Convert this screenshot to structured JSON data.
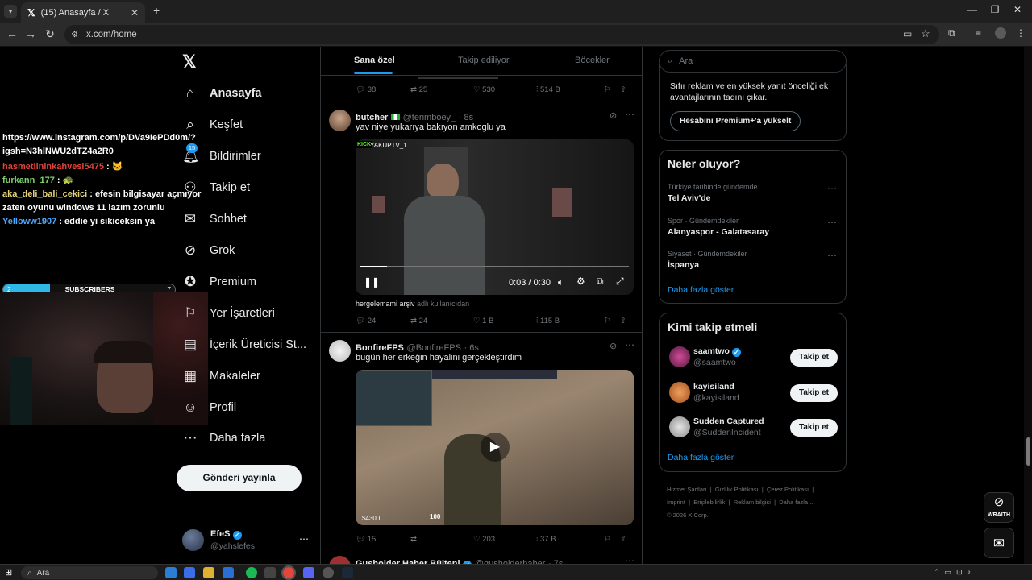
{
  "browser": {
    "tab_title": "(15) Anasayfa / X",
    "url": "x.com/home"
  },
  "overlay": {
    "chat": [
      {
        "user": "",
        "text": "https://www.instagram.com/p/DVa9IePDd0m/?igsh=N3hlNWU2dTZ4a2R0",
        "color": "#ffffff"
      },
      {
        "user": "hasmetlininkahvesi5475",
        "text": " : 🐱",
        "color": "#e0433a"
      },
      {
        "user": "furkann_177",
        "text": " : 🐢",
        "color": "#7bd16b"
      },
      {
        "user": "aka_deli_bali_cekici",
        "text": " : efesin bilgisayar açmıyor zaten oyunu windows 11 lazım zorunlu",
        "color": "#e3d37a"
      },
      {
        "user": "Yelloww1907",
        "text": " : eddie yi sikiceksin ya",
        "color": "#4aa8ff"
      }
    ],
    "subs_label": "SUBSCRIBERS",
    "subs_current": "2",
    "subs_goal": "7",
    "subs_progress": 0.27
  },
  "nav": {
    "items": [
      {
        "label": "Anasayfa",
        "icon": "home-icon"
      },
      {
        "label": "Keşfet",
        "icon": "search-icon"
      },
      {
        "label": "Bildirimler",
        "icon": "bell-icon",
        "badge": "15"
      },
      {
        "label": "Takip et",
        "icon": "follow-icon"
      },
      {
        "label": "Sohbet",
        "icon": "mail-icon"
      },
      {
        "label": "Grok",
        "icon": "grok-icon"
      },
      {
        "label": "Premium",
        "icon": "premium-icon"
      },
      {
        "label": "Yer İşaretleri",
        "icon": "bookmark-icon"
      },
      {
        "label": "İçerik Üreticisi St...",
        "icon": "creator-icon"
      },
      {
        "label": "Makaleler",
        "icon": "article-icon"
      },
      {
        "label": "Profil",
        "icon": "profile-icon"
      },
      {
        "label": "Daha fazla",
        "icon": "more-icon"
      }
    ],
    "post_button": "Gönderi yayınla",
    "account_name": "EfeS",
    "account_handle": "@yahslefes"
  },
  "feed": {
    "tabs": [
      "Sana özel",
      "Takip ediliyor",
      "Böcekler"
    ],
    "top_actions": {
      "replies": "38",
      "reposts": "25",
      "likes": "530",
      "views": "514 B"
    },
    "tweets": [
      {
        "name": "butcher",
        "handle": "@terimboey_",
        "time": "· 8s",
        "text": "yav niye yukarıya bakıyon amkoglu ya",
        "video_tag": "YAKUPTV_1",
        "video_time": "0:03 / 0:30",
        "video_progress": 0.1,
        "source": "hergelemami arşiv",
        "source_sub": "adlı kullanıcıdan",
        "actions": {
          "replies": "24",
          "reposts": "24",
          "likes": "1 B",
          "views": "115 B"
        }
      },
      {
        "name": "BonfireFPS",
        "handle": "@BonfireFPS",
        "time": "· 6s",
        "text": "bugün her erkeğin hayalini gerçekleştirdim",
        "hud_money": "$4300",
        "hud_hp": "100",
        "actions": {
          "replies": "15",
          "reposts": "",
          "likes": "203",
          "views": "37 B"
        }
      },
      {
        "name": "Gusholder Haber Bülteni",
        "handle": "@gusholderhaber",
        "time": "· 7s"
      }
    ]
  },
  "right": {
    "search_placeholder": "Ara",
    "premium_text": "Sıfır reklam ve en yüksek yanıt önceliği ek avantajlarının tadını çıkar.",
    "premium_button": "Hesabını Premium+'a yükselt",
    "trends_title": "Neler oluyor?",
    "trends": [
      {
        "meta": "Türkiye tarihinde gündemde",
        "title": "Tel Aviv'de"
      },
      {
        "meta": "Spor · Gündemdekiler",
        "title": "Alanyaspor - Galatasaray"
      },
      {
        "meta": "Siyaset · Gündemdekiler",
        "title": "İspanya"
      }
    ],
    "show_more": "Daha fazla göster",
    "who_title": "Kimi takip etmeli",
    "who": [
      {
        "name": "saamtwo",
        "handle": "@saamtwo",
        "verified": true
      },
      {
        "name": "kayisiland",
        "handle": "@kayisiland",
        "verified": false
      },
      {
        "name": "Sudden Captured",
        "handle": "@SuddenIncident",
        "verified": false
      }
    ],
    "follow_label": "Takip et",
    "footer": [
      "Hizmet Şartları",
      "Gizlilik Politikası",
      "Çerez Politikası",
      "Imprint",
      "Erişilebilirlik",
      "Reklam bilgisi",
      "Daha fazla ...",
      "© 2026 X Corp."
    ]
  },
  "wraith_label": "WRAITH",
  "taskbar": {
    "search": "Ara"
  }
}
